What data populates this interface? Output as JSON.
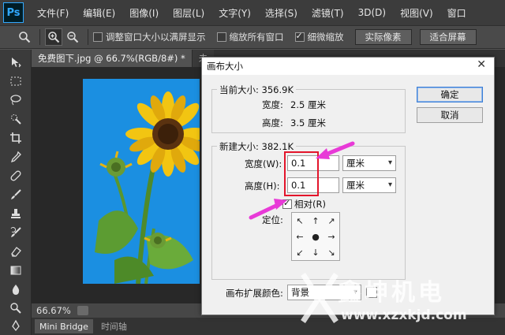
{
  "app": {
    "logo": "Ps"
  },
  "menu": [
    "文件(F)",
    "编辑(E)",
    "图像(I)",
    "图层(L)",
    "文字(Y)",
    "选择(S)",
    "滤镜(T)",
    "3D(D)",
    "视图(V)",
    "窗口"
  ],
  "options": {
    "resize_windows": "调整窗口大小以满屏显示",
    "zoom_all": "缩放所有窗口",
    "scrubby_zoom": "细微缩放",
    "actual_pixels": "实际像素",
    "fit_screen": "适合屏幕"
  },
  "document": {
    "tab_active": "免费图下.jpg @ 66.7%(RGB/8#) *",
    "tab_inactive": "未",
    "zoom": "66.67%"
  },
  "bottom_tabs": [
    "Mini Bridge",
    "时间轴"
  ],
  "dialog": {
    "title": "画布大小",
    "current_size": "当前大小: 356.9K",
    "width_label": "宽度:",
    "width_value": "2.5 厘米",
    "height_label": "高度:",
    "height_value": "3.5 厘米",
    "new_size": "新建大小: 382.1K",
    "new_width_label": "宽度(W):",
    "new_width_value": "0.1",
    "new_width_unit": "厘米",
    "new_height_label": "高度(H):",
    "new_height_value": "0.1",
    "new_height_unit": "厘米",
    "relative_label": "相对(R)",
    "anchor_label": "定位:",
    "anchor_cells": [
      "↖",
      "↑",
      "↗",
      "←",
      "●",
      "→",
      "↙",
      "↓",
      "↘"
    ],
    "extension_color_label": "画布扩展颜色:",
    "extension_color_value": "背景",
    "ok": "确定",
    "cancel": "取消"
  },
  "watermark": {
    "text": "鑫坤机电",
    "url": "www.xzxkjd.com"
  },
  "colors": {
    "highlight_red": "#e3152b",
    "arrow_magenta": "#e83ad7"
  }
}
